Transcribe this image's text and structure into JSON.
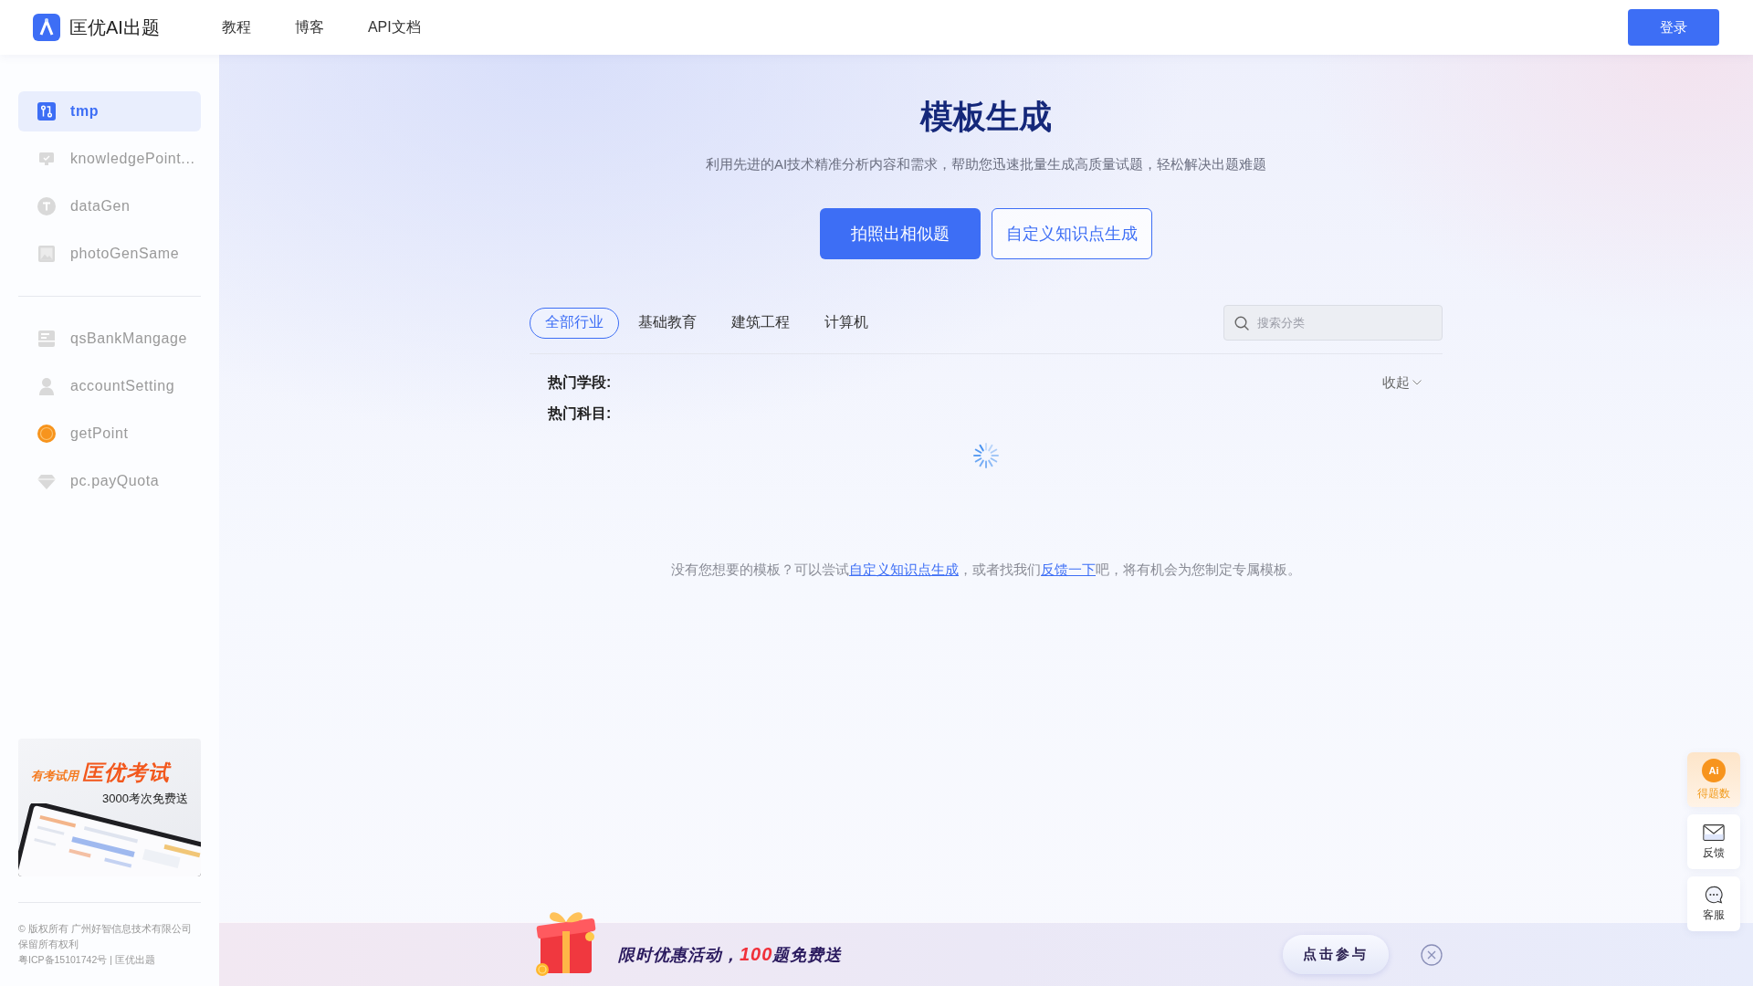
{
  "header": {
    "logo_text": "匡优AI出题",
    "nav": [
      {
        "label": "教程"
      },
      {
        "label": "博客"
      },
      {
        "label": "API文档"
      }
    ],
    "login_button": "登录"
  },
  "sidebar": {
    "groups": [
      {
        "items": [
          {
            "label": "tmp",
            "selected": true
          },
          {
            "label": "knowledgePoint...",
            "selected": false
          },
          {
            "label": "dataGen",
            "selected": false
          },
          {
            "label": "photoGenSame",
            "selected": false
          }
        ]
      },
      {
        "items": [
          {
            "label": "qsBankMangage",
            "selected": false
          },
          {
            "label": "accountSetting",
            "selected": false
          },
          {
            "label": "getPoint",
            "selected": false
          },
          {
            "label": "pc.payQuota",
            "selected": false
          }
        ]
      }
    ],
    "promo": {
      "tagline": "有考试用",
      "brand": "匡优考试",
      "offer": "3000考次免费送"
    },
    "footer": [
      "© 版权所有 广州好智信息技术有限公司",
      "保留所有权利",
      "粤ICP备15101742号 | 匡优出题"
    ]
  },
  "main": {
    "title": "模板生成",
    "subtitle": "利用先进的AI技术精准分析内容和需求，帮助您迅速批量生成高质量试题，轻松解决出题难题",
    "actions": [
      {
        "label": "拍照出相似题",
        "kind": "primary"
      },
      {
        "label": "自定义知识点生成",
        "kind": "outline"
      }
    ],
    "category_tabs": [
      {
        "label": "全部行业",
        "selected": true
      },
      {
        "label": "基础教育",
        "selected": false
      },
      {
        "label": "建筑工程",
        "selected": false
      },
      {
        "label": "计算机",
        "selected": false
      }
    ],
    "search": {
      "placeholder": "搜索分类"
    },
    "filters": [
      {
        "label": "热门学段:"
      },
      {
        "label": "热门科目:"
      }
    ],
    "collapse_toggle": "收起",
    "loading": true,
    "hint": [
      {
        "kind": "text",
        "text": "没有您想要的模板？可以尝试"
      },
      {
        "kind": "link",
        "text": "自定义知识点生成"
      },
      {
        "kind": "text",
        "text": "，或者找我们"
      },
      {
        "kind": "link",
        "text": "反馈一下"
      },
      {
        "kind": "text",
        "text": "吧，将有机会为您制定专属模板。"
      }
    ]
  },
  "float_actions": [
    {
      "kind": "points",
      "badge": "Ai",
      "label": "得题数"
    },
    {
      "kind": "mail",
      "label": "反馈"
    },
    {
      "kind": "chat",
      "label": "客服"
    }
  ],
  "promo_bar": {
    "text": "限时优惠活动，**100**题免费送",
    "button": "点击参与"
  }
}
